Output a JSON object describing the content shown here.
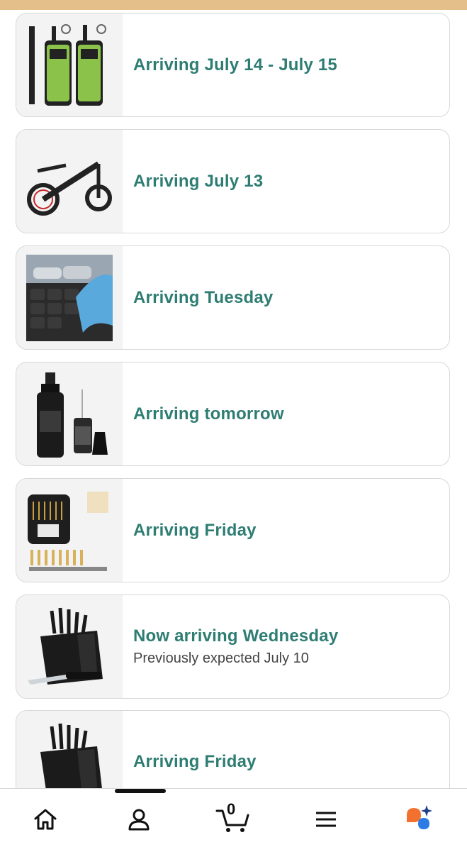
{
  "orders": [
    {
      "image": "walkie-talkie-pair-image",
      "status": "Arriving July 14 - July 15",
      "sub": ""
    },
    {
      "image": "electric-scooter-image",
      "status": "Arriving July 13",
      "sub": ""
    },
    {
      "image": "mattress-topper-image",
      "status": "Arriving Tuesday",
      "sub": ""
    },
    {
      "image": "gun-oil-spray-bottle-image",
      "status": "Arriving tomorrow",
      "sub": ""
    },
    {
      "image": "gun-cleaning-kit-image",
      "status": "Arriving Friday",
      "sub": ""
    },
    {
      "image": "knife-block-set-image",
      "status": "Now arriving Wednesday",
      "sub": "Previously expected July 10"
    },
    {
      "image": "knife-block-set-image",
      "status": "Arriving Friday",
      "sub": ""
    }
  ],
  "nav": {
    "home_icon": "home-icon",
    "account_icon": "person-icon",
    "cart_icon": "cart-icon",
    "cart_count": "0",
    "menu_icon": "hamburger-icon",
    "assistant_icon": "assistant-icon"
  },
  "colors": {
    "status_text": "#2e7d73",
    "top_bar": "#e4bf8a",
    "card_border": "#d5d9d9"
  }
}
